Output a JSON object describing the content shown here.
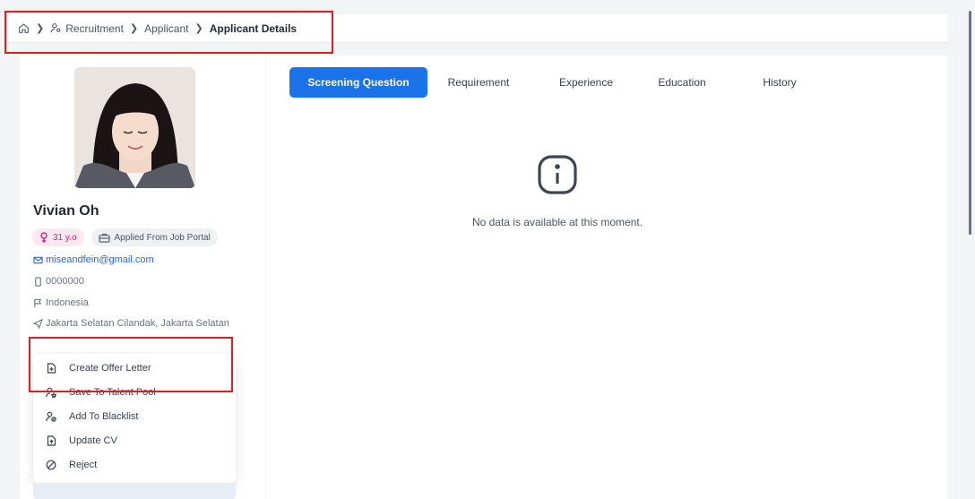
{
  "breadcrumb": {
    "home_icon": "home-icon",
    "items": [
      "Recruitment",
      "Applicant",
      "Applicant Details"
    ]
  },
  "profile": {
    "name": "Vivian Oh",
    "age_badge": "31 y.o",
    "source_badge": "Applied From Job Portal",
    "email": "miseandfein@gmail.com",
    "phone": "0000000",
    "country": "Indonesia",
    "address": "Jakarta Selatan Cilandak, Jakarta Selatan"
  },
  "actions": [
    {
      "label": "Create Offer Letter",
      "icon": "file-plus-icon"
    },
    {
      "label": "Save To Talent Pool",
      "icon": "user-star-icon"
    },
    {
      "label": "Add To Blacklist",
      "icon": "user-block-icon"
    },
    {
      "label": "Update CV",
      "icon": "file-upload-icon"
    },
    {
      "label": "Reject",
      "icon": "ban-icon"
    }
  ],
  "tabs": [
    {
      "label": "Screening Question",
      "active": true
    },
    {
      "label": "Requirement",
      "active": false
    },
    {
      "label": "Experience",
      "active": false
    },
    {
      "label": "Education",
      "active": false
    },
    {
      "label": "History",
      "active": false
    }
  ],
  "empty_state": {
    "icon": "info-icon",
    "message": "No data is available at this moment."
  },
  "colors": {
    "accent": "#1a73e8",
    "highlight": "#e11d1d",
    "age_badge": "#db2777",
    "email": "#2563eb"
  }
}
